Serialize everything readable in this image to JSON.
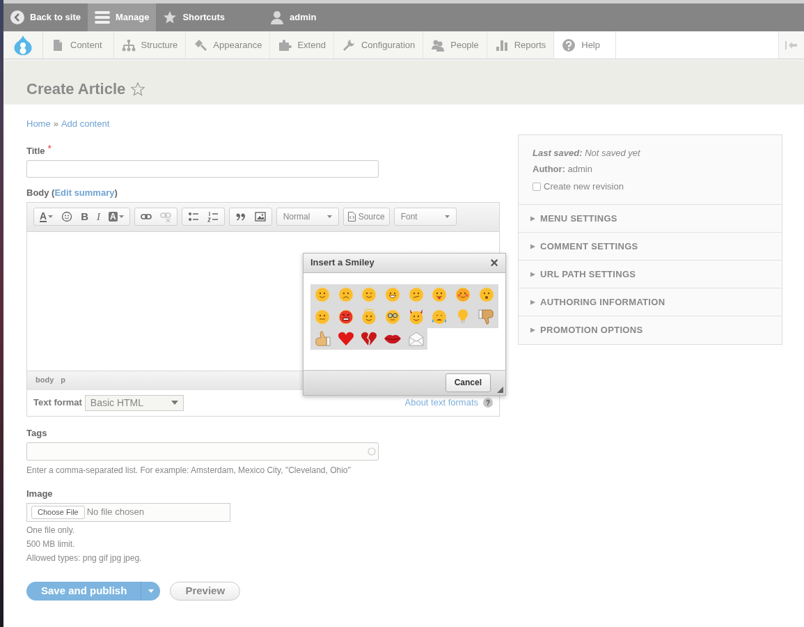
{
  "toolbar_top": [
    {
      "label": "Back to site",
      "selected": false
    },
    {
      "label": "Manage",
      "selected": true
    },
    {
      "label": "Shortcuts",
      "selected": false
    },
    {
      "label": "admin",
      "selected": false
    }
  ],
  "admin_menu": [
    {
      "label": "Content"
    },
    {
      "label": "Structure"
    },
    {
      "label": "Appearance"
    },
    {
      "label": "Extend"
    },
    {
      "label": "Configuration"
    },
    {
      "label": "People"
    },
    {
      "label": "Reports"
    },
    {
      "label": "Help"
    }
  ],
  "page_title": "Create Article",
  "breadcrumb": {
    "home": "Home",
    "separator": "»",
    "current": "Add content"
  },
  "title_field": {
    "label": "Title",
    "required_mark": "*"
  },
  "body": {
    "label_prefix": "Body (",
    "link": "Edit summary",
    "label_suffix": ")",
    "toolbar": {
      "groups": [
        [
          {
            "kind": "text-color",
            "glyph": "A"
          },
          {
            "kind": "smiley"
          },
          {
            "kind": "bold",
            "glyph": "B"
          },
          {
            "kind": "italic",
            "glyph": "I"
          },
          {
            "kind": "bg-color",
            "glyph": "A"
          }
        ],
        [
          {
            "kind": "link",
            "disabled": false
          },
          {
            "kind": "unlink",
            "disabled": true
          }
        ],
        [
          {
            "kind": "bullets"
          },
          {
            "kind": "numbers"
          }
        ],
        [
          {
            "kind": "quote"
          },
          {
            "kind": "image"
          }
        ]
      ],
      "format": "Normal",
      "source": "Source",
      "font": "Font"
    },
    "path": [
      "body",
      "p"
    ],
    "text_format_label": "Text format",
    "text_format_value": "Basic HTML",
    "about_link": "About text formats",
    "help_mark": "?"
  },
  "dialog": {
    "title": "Insert a Smiley",
    "close": "×",
    "cancel": "Cancel"
  },
  "tags": {
    "label": "Tags",
    "description": "Enter a comma-separated list. For example: Amsterdam, Mexico City, \"Cleveland, Ohio\""
  },
  "image": {
    "label": "Image",
    "choose": "Choose File",
    "status": "No file chosen",
    "notes": [
      "One file only.",
      "500 MB limit.",
      "Allowed types: png gif jpg jpeg."
    ]
  },
  "actions": {
    "save": "Save and publish",
    "preview": "Preview"
  },
  "sidebar": {
    "last_saved": "**Last saved:** Not saved yet",
    "author": "**Author:** admin",
    "revision": {
      "label": "Create new revision",
      "checked": false
    },
    "sections": [
      {
        "label": "MENU SETTINGS",
        "expanded": false
      },
      {
        "label": "COMMENT SETTINGS",
        "expanded": false
      },
      {
        "label": "URL PATH SETTINGS",
        "expanded": false
      },
      {
        "label": "AUTHORING INFORMATION",
        "expanded": false
      },
      {
        "label": "PROMOTION OPTIONS",
        "expanded": false
      }
    ]
  }
}
